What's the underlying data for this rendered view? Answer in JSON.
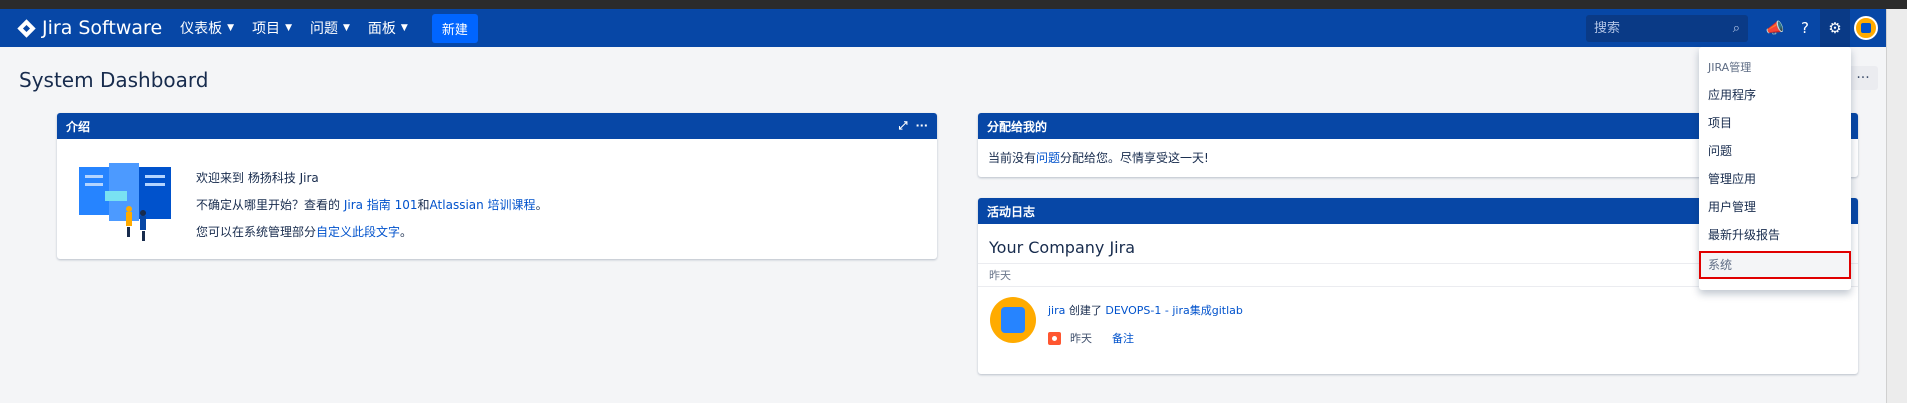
{
  "nav": {
    "logo": "Jira Software",
    "menu": [
      {
        "label": "仪表板"
      },
      {
        "label": "项目"
      },
      {
        "label": "问题"
      },
      {
        "label": "面板"
      }
    ],
    "create": "新建",
    "search_placeholder": "搜索"
  },
  "page": {
    "title": "System Dashboard",
    "more": "···"
  },
  "intro": {
    "title": "介绍",
    "line1": "欢迎来到 杨扬科技 Jira",
    "line2_prefix": "不确定从哪里开始？查看的 ",
    "line2_link1": "Jira 指南 101",
    "line2_mid": "和",
    "line2_link2": "Atlassian 培训课程",
    "line2_suffix": "。",
    "line3_prefix": "您可以在系统管理部分",
    "line3_link": "自定义此段文字",
    "line3_suffix": "。"
  },
  "assigned": {
    "title": "分配给我的",
    "prefix": "当前没有",
    "link": "问题",
    "suffix": "分配给您。尽情享受这一天!"
  },
  "activity": {
    "title": "活动日志",
    "stream_title": "Your Company Jira",
    "date": "昨天",
    "user": "jira",
    "action": " 创建了 ",
    "issue": "DEVOPS-1 - jira集成gitlab",
    "time": "昨天",
    "comment": "备注"
  },
  "admin_menu": {
    "header": "JIRA管理",
    "items": [
      "应用程序",
      "项目",
      "问题",
      "管理应用",
      "用户管理",
      "最新升级报告",
      "系统"
    ],
    "selected": "系统"
  }
}
